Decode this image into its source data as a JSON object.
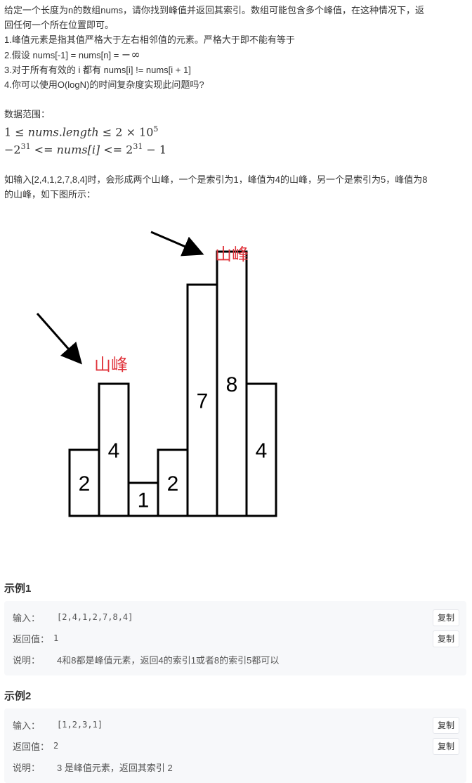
{
  "description": {
    "line1": "给定一个长度为n的数组nums，请你找到峰值并返回其索引。数组可能包含多个峰值，在这种情况下，返",
    "line2": "回任何一个所在位置即可。",
    "rule1": "1.峰值元素是指其值严格大于左右相邻值的元素。严格大于即不能有等于",
    "rule2_prefix": "2.假设 nums[-1] = nums[n] = ",
    "rule2_math": "−∞",
    "rule3": "3.对于所有有效的 i 都有 nums[i] != nums[i + 1]",
    "rule4": "4.你可以使用O(logN)的时间复杂度实现此问题吗?",
    "range_title": "数据范围：",
    "range1": {
      "left": "1 ≤ ",
      "var": "nums.length",
      "mid": " ≤ 2 × 10",
      "exp": "5"
    },
    "range2": {
      "left": "−2",
      "exp1": "31",
      "op1": " <= ",
      "var": "nums[i]",
      "op2": " <= 2",
      "exp2": "31",
      "right": " − 1"
    },
    "example_intro1": "如输入[2,4,1,2,7,8,4]时，会形成两个山峰，一个是索引为1，峰值为4的山峰，另一个是索引为5，峰值为8",
    "example_intro2": "的山峰，如下图所示："
  },
  "figure": {
    "values": [
      2,
      4,
      1,
      2,
      7,
      8,
      4
    ],
    "peak_label_left": "山峰",
    "peak_label_right": "山峰",
    "bar_color": "#000000",
    "label_color": "#e0343c"
  },
  "examples": [
    {
      "title": "示例1",
      "input_label": "输入：",
      "input_value": "[2,4,1,2,7,8,4]",
      "output_label": "返回值：",
      "output_value": "1",
      "explain_label": "说明：",
      "explain_value": "4和8都是峰值元素，返回4的索引1或者8的索引5都可以",
      "copy_label": "复制"
    },
    {
      "title": "示例2",
      "input_label": "输入：",
      "input_value": "[1,2,3,1]",
      "output_label": "返回值：",
      "output_value": "2",
      "explain_label": "说明：",
      "explain_value": "3 是峰值元素，返回其索引 2",
      "copy_label": "复制"
    }
  ]
}
